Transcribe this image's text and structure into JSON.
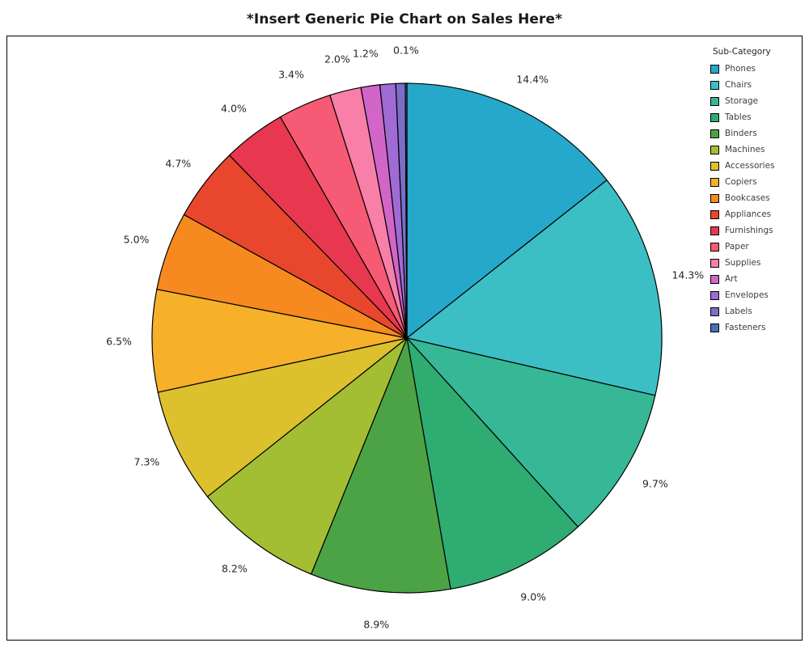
{
  "chart_data": {
    "type": "pie",
    "title": "*Insert Generic Pie Chart on Sales Here*",
    "legend_title": "Sub-Category",
    "legend_position": "right",
    "start_angle_deg": 90,
    "direction": "clockwise",
    "autopct_format": "%.1f%%",
    "wedge_edge_color": "#000000",
    "categories": [
      "Phones",
      "Chairs",
      "Storage",
      "Tables",
      "Binders",
      "Machines",
      "Accessories",
      "Copiers",
      "Bookcases",
      "Appliances",
      "Furnishings",
      "Paper",
      "Supplies",
      "Art",
      "Envelopes",
      "Labels",
      "Fasteners"
    ],
    "values": [
      14.4,
      14.3,
      9.7,
      9.0,
      8.9,
      8.2,
      7.3,
      6.5,
      5.0,
      4.7,
      4.0,
      3.4,
      2.0,
      1.2,
      1.0,
      0.6,
      0.1
    ],
    "labels": [
      "14.4%",
      "14.3%",
      "9.7%",
      "9.0%",
      "8.9%",
      "8.2%",
      "7.3%",
      "6.5%",
      "5.0%",
      "4.7%",
      "4.0%",
      "3.4%",
      "2.0%",
      "1.2%",
      "",
      "",
      "0.1%"
    ],
    "colors": [
      "#26a8cb",
      "#3bbfc4",
      "#36b897",
      "#2eac72",
      "#4ba345",
      "#a4be33",
      "#dcc02e",
      "#f7b02a",
      "#f6891f",
      "#e8472e",
      "#e8384f",
      "#f65a74",
      "#f77fa8",
      "#d165c8",
      "#a06bd4",
      "#7a6ec9",
      "#4a6fb5"
    ],
    "xlabel": "",
    "ylabel": "",
    "grid": false
  },
  "legend": {
    "title": "Sub-Category",
    "items": [
      {
        "label": "Phones",
        "color": "#26a8cb"
      },
      {
        "label": "Chairs",
        "color": "#3bbfc4"
      },
      {
        "label": "Storage",
        "color": "#36b897"
      },
      {
        "label": "Tables",
        "color": "#2eac72"
      },
      {
        "label": "Binders",
        "color": "#4ba345"
      },
      {
        "label": "Machines",
        "color": "#a4be33"
      },
      {
        "label": "Accessories",
        "color": "#dcc02e"
      },
      {
        "label": "Copiers",
        "color": "#f7b02a"
      },
      {
        "label": "Bookcases",
        "color": "#f6891f"
      },
      {
        "label": "Appliances",
        "color": "#e8472e"
      },
      {
        "label": "Furnishings",
        "color": "#e8384f"
      },
      {
        "label": "Paper",
        "color": "#f65a74"
      },
      {
        "label": "Supplies",
        "color": "#f77fa8"
      },
      {
        "label": "Art",
        "color": "#d165c8"
      },
      {
        "label": "Envelopes",
        "color": "#a06bd4"
      },
      {
        "label": "Labels",
        "color": "#7a6ec9"
      },
      {
        "label": "Fasteners",
        "color": "#4a6fb5"
      }
    ]
  }
}
